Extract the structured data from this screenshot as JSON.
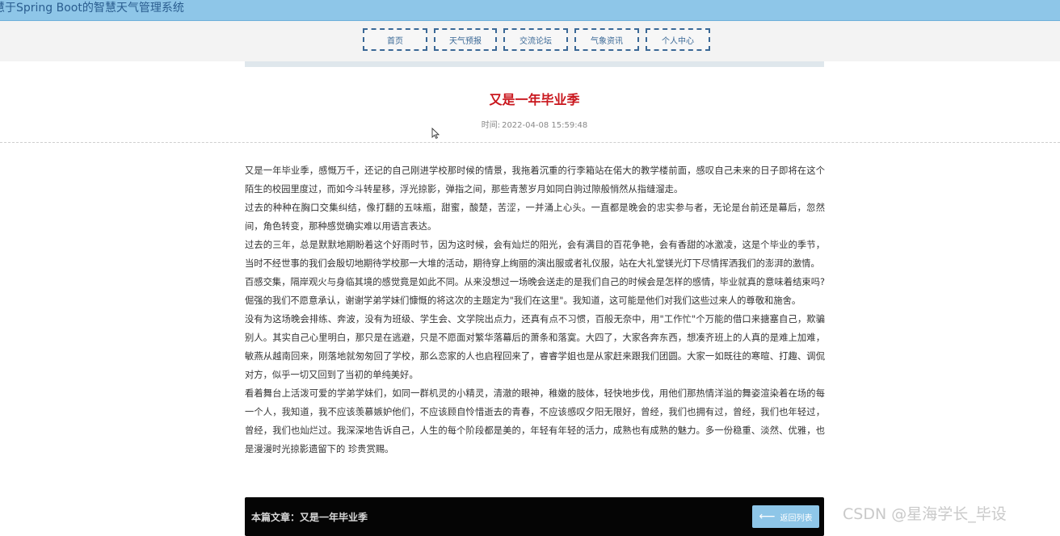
{
  "app": {
    "title": "慧于Spring Boot的智慧天气管理系统"
  },
  "nav": {
    "items": [
      {
        "label": "首页"
      },
      {
        "label": "天气预报"
      },
      {
        "label": "交流论坛"
      },
      {
        "label": "气象资讯"
      },
      {
        "label": "个人中心"
      }
    ]
  },
  "article": {
    "title": "又是一年毕业季",
    "time_label": "时间:",
    "time_value": "2022-04-08 15:59:48",
    "paragraphs": [
      "又是一年毕业季，感慨万千，还记的自己刚进学校那时候的情景，我拖着沉重的行李箱站在偌大的教学楼前面，感叹自己未来的日子即将在这个陌生的校园里度过，而如今斗转星移，浮光掠影，弹指之间，那些青葱岁月如同白驹过隙般悄然从指缝溜走。",
      "过去的种种在胸口交集纠结，像打翻的五味瓶，甜蜜，酸楚，苦涩，一并涌上心头。一直都是晚会的忠实参与者，无论是台前还是幕后，忽然间，角色转变，那种感觉确实难以用语言表达。",
      "过去的三年，总是默默地期盼着这个好雨时节，因为这时候，会有灿烂的阳光，会有满目的百花争艳，会有香甜的冰激凌，这是个毕业的季节，当时不经世事的我们会殷切地期待学校那一大堆的活动，期待穿上绚丽的演出服或者礼仪服，站在大礼堂镁光灯下尽情挥洒我们的澎湃的激情。",
      "百感交集，隔岸观火与身临其境的感觉竟是如此不同。从来没想过一场晚会送走的是我们自己的时候会是怎样的感情，毕业就真的意味着结束吗?倔强的我们不愿意承认，谢谢学弟学妹们慷慨的将这次的主题定为\"我们在这里\"。我知道，这可能是他们对我们这些过来人的尊敬和施舍。",
      "没有为这场晚会排练、奔波，没有为班级、学生会、文学院出点力，还真有点不习惯，百般无奈中，用\"工作忙\"个万能的借口来搪塞自己，欺骗别人。其实自己心里明白，那只是在逃避，只是不愿面对繁华落幕后的萧条和落寞。大四了，大家各奔东西，想凑齐班上的人真的是难上加难，敏燕从越南回来，刚落地就匆匆回了学校，那么恋家的人也启程回来了，睿睿学姐也是从家赶来跟我们团圆。大家一如既往的寒暄、打趣、调侃对方，似乎一切又回到了当初的单纯美好。",
      "看着舞台上活泼可爱的学弟学妹们，如同一群机灵的小精灵，清澈的眼神，稚嫩的肢体，轻快地步伐，用他们那热情洋溢的舞姿渲染着在场的每一个人，我知道，我不应该羡慕嫉妒他们，不应该顾自怜惜逝去的青春，不应该感叹夕阳无限好，曾经，我们也拥有过，曾经，我们也年轻过，曾经，我们也灿烂过。我深深地告诉自己，人生的每个阶段都是美的，年轻有年轻的活力，成熟也有成熟的魅力。多一份稳重、淡然、优雅，也是漫漫时光掠影遗留下的 珍贵赏赐。"
    ]
  },
  "footer": {
    "current_label": "本篇文章：又是一年毕业季",
    "back_label": "返回列表",
    "back_icon": "arrow-left-icon"
  },
  "watermark": {
    "text": "CSDN @星海学长_毕设"
  },
  "colors": {
    "title_bar": "#8ec6e8",
    "nav_border": "#3a6896",
    "article_title": "#c9161d",
    "footer_bg": "#050505",
    "back_button": "#8ec6e8"
  }
}
